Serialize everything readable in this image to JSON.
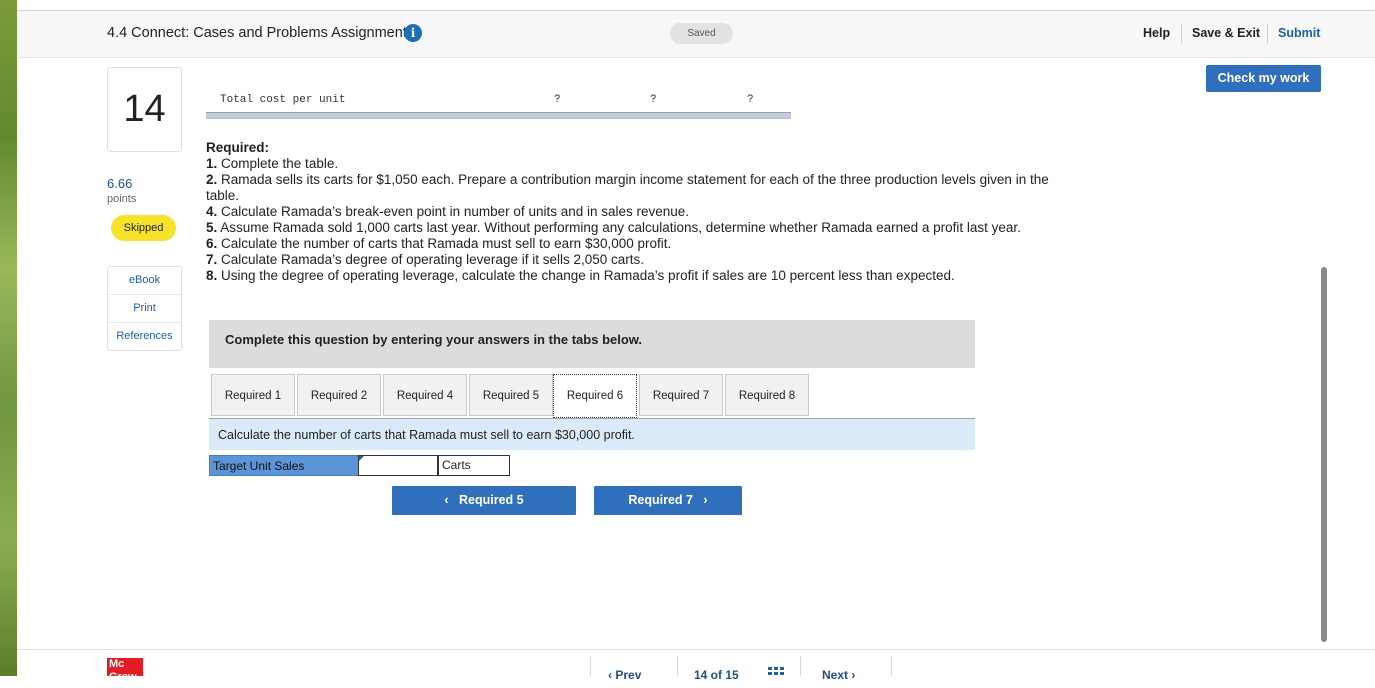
{
  "header": {
    "title": "4.4 Connect: Cases and Problems Assignment",
    "saved_status": "Saved",
    "help": "Help",
    "save_exit": "Save & Exit",
    "submit": "Submit"
  },
  "check_my_work": "Check my work",
  "question": {
    "number": "14",
    "points_value": "6.66",
    "points_label": "points",
    "status": "Skipped"
  },
  "side_links": [
    "eBook",
    "Print",
    "References"
  ],
  "table_remnant": {
    "label": "Total cost per unit",
    "cells": [
      "?",
      "?",
      "?"
    ]
  },
  "required": {
    "heading": "Required:",
    "items": [
      {
        "num": "1.",
        "text": " Complete the table."
      },
      {
        "num": "2.",
        "text": " Ramada sells its carts for $1,050 each. Prepare a contribution margin income statement for each of the three production levels given in the table."
      },
      {
        "num": "4.",
        "text": " Calculate Ramada’s break-even point in number of units and in sales revenue."
      },
      {
        "num": "5.",
        "text": " Assume Ramada sold 1,000 carts last year. Without performing any calculations, determine whether Ramada earned a profit last year."
      },
      {
        "num": "6.",
        "text": " Calculate the number of carts that Ramada must sell to earn $30,000 profit."
      },
      {
        "num": "7.",
        "text": " Calculate Ramada’s degree of operating leverage if it sells 2,050 carts."
      },
      {
        "num": "8.",
        "text": " Using the degree of operating leverage, calculate the change in Ramada’s profit if sales are 10 percent less than expected."
      }
    ]
  },
  "instructions": "Complete this question by entering your answers in the tabs below.",
  "tabs": [
    "Required 1",
    "Required 2",
    "Required 4",
    "Required 5",
    "Required 6",
    "Required 7",
    "Required 8"
  ],
  "active_tab": "Required 6",
  "tab_description": "Calculate the number of carts that Ramada must sell to earn $30,000 profit.",
  "answer_row": {
    "label": "Target Unit Sales",
    "value": "",
    "unit": "Carts"
  },
  "nav": {
    "prev_label": "Required 5",
    "next_label": "Required 7"
  },
  "footer": {
    "logo": "Mc Graw",
    "prev": "Prev",
    "position": "14 of 15",
    "next": "Next"
  },
  "colors": {
    "accent_blue": "#2f6fbb",
    "skipped_yellow": "#f7e22b",
    "description_bg": "#dbeaf8",
    "logo_red": "#e31b23"
  }
}
